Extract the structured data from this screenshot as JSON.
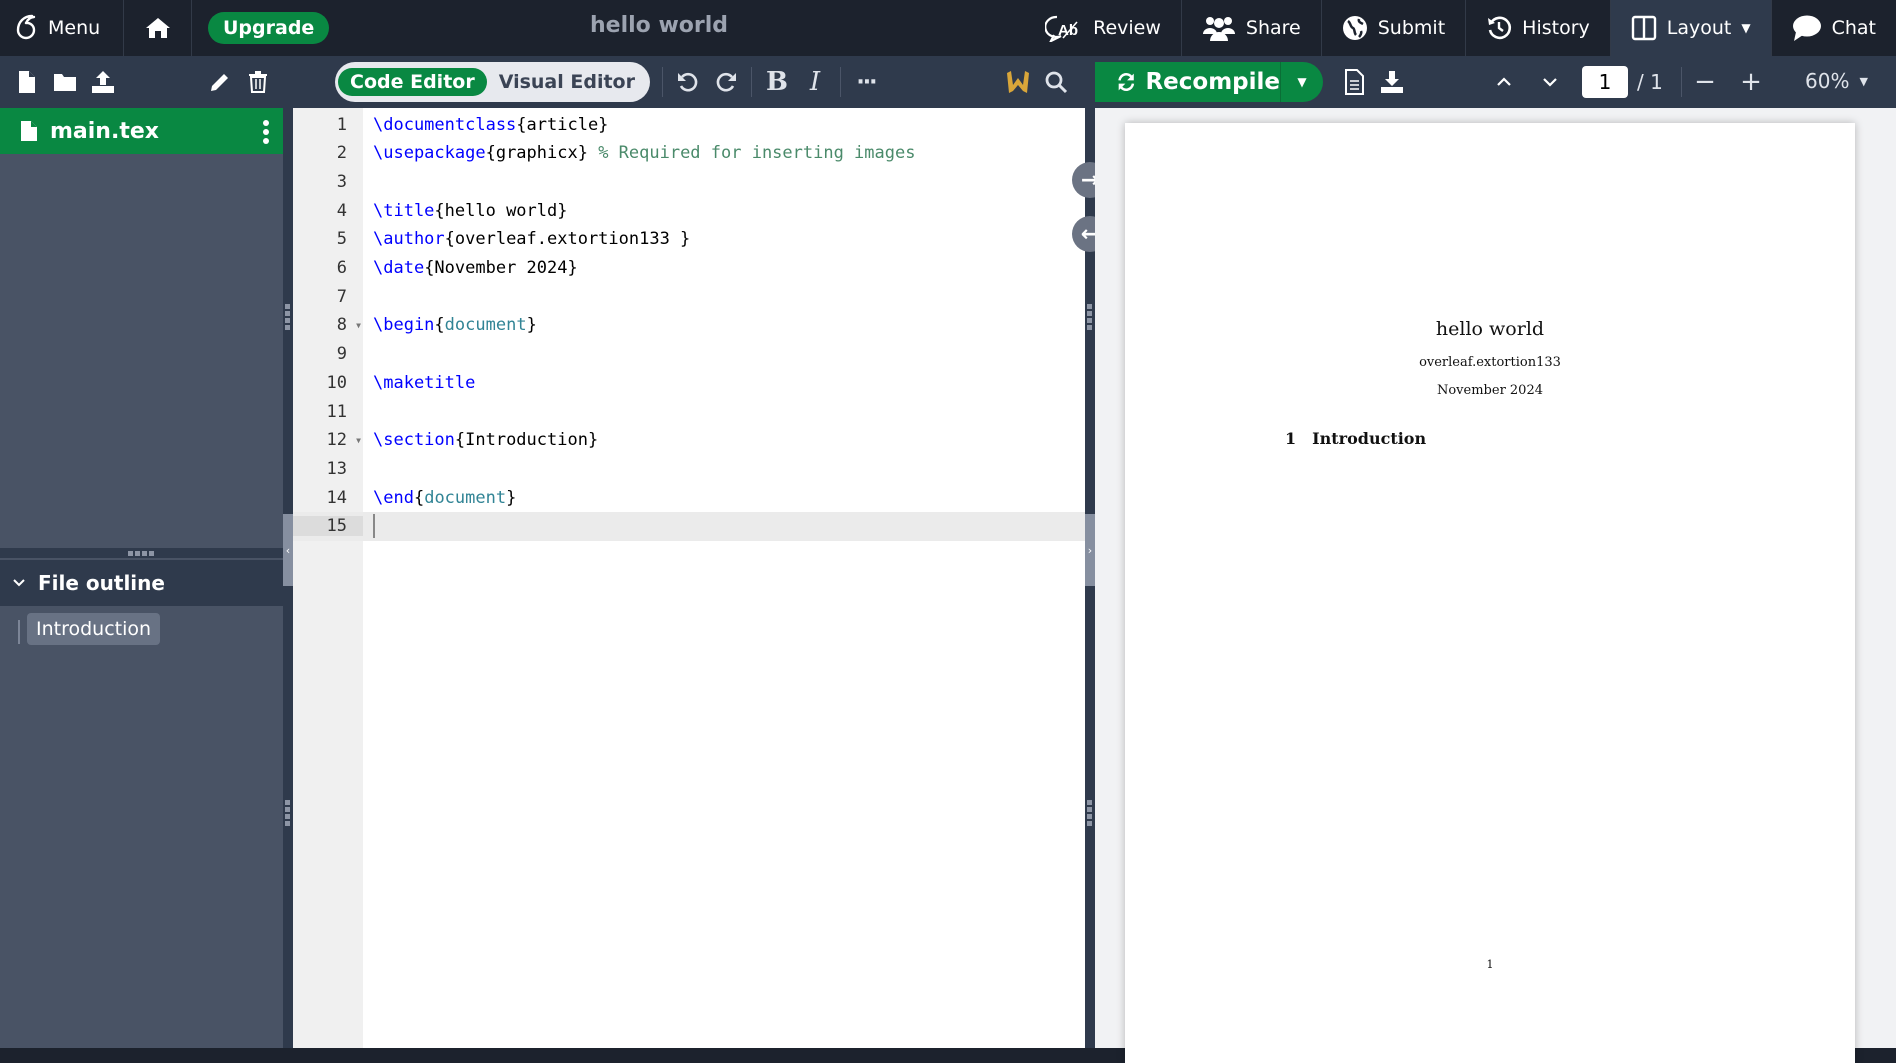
{
  "topbar": {
    "menu_label": "Menu",
    "upgrade_label": "Upgrade",
    "project_title": "hello world",
    "actions": [
      {
        "id": "review",
        "label": "Review",
        "icon": "review-icon"
      },
      {
        "id": "share",
        "label": "Share",
        "icon": "users-icon"
      },
      {
        "id": "submit",
        "label": "Submit",
        "icon": "globe-icon"
      },
      {
        "id": "history",
        "label": "History",
        "icon": "history-icon"
      },
      {
        "id": "layout",
        "label": "Layout",
        "icon": "layout-icon"
      },
      {
        "id": "chat",
        "label": "Chat",
        "icon": "chat-icon"
      }
    ]
  },
  "editor_toolbar": {
    "code_editor_label": "Code Editor",
    "visual_editor_label": "Visual Editor",
    "active_mode": "Code Editor"
  },
  "file_tree": {
    "files": [
      {
        "name": "main.tex",
        "selected": true
      }
    ]
  },
  "outline": {
    "title": "File outline",
    "items": [
      "Introduction"
    ]
  },
  "editor": {
    "lines": [
      {
        "n": "1",
        "parts": [
          [
            "kw",
            "\\documentclass"
          ],
          [
            "",
            "{article}"
          ]
        ]
      },
      {
        "n": "2",
        "parts": [
          [
            "kw",
            "\\usepackage"
          ],
          [
            "",
            "{graphicx} "
          ],
          [
            "cm",
            "% Required for inserting images"
          ]
        ]
      },
      {
        "n": "3",
        "parts": []
      },
      {
        "n": "4",
        "parts": [
          [
            "kw",
            "\\title"
          ],
          [
            "",
            "{hello world}"
          ]
        ]
      },
      {
        "n": "5",
        "parts": [
          [
            "kw",
            "\\author"
          ],
          [
            "",
            "{overleaf.extortion133 }"
          ]
        ]
      },
      {
        "n": "6",
        "parts": [
          [
            "kw",
            "\\date"
          ],
          [
            "",
            "{November 2024}"
          ]
        ]
      },
      {
        "n": "7",
        "parts": []
      },
      {
        "n": "8",
        "fold": true,
        "parts": [
          [
            "kw",
            "\\begin"
          ],
          [
            "",
            "{"
          ],
          [
            "env",
            "document"
          ],
          [
            "",
            "}"
          ]
        ]
      },
      {
        "n": "9",
        "parts": []
      },
      {
        "n": "10",
        "parts": [
          [
            "kw",
            "\\maketitle"
          ]
        ]
      },
      {
        "n": "11",
        "parts": []
      },
      {
        "n": "12",
        "fold": true,
        "parts": [
          [
            "kw",
            "\\section"
          ],
          [
            "",
            "{Introduction}"
          ]
        ]
      },
      {
        "n": "13",
        "parts": []
      },
      {
        "n": "14",
        "parts": [
          [
            "kw",
            "\\end"
          ],
          [
            "",
            "{"
          ],
          [
            "env",
            "document"
          ],
          [
            "",
            "}"
          ]
        ]
      },
      {
        "n": "15",
        "active": true,
        "parts": []
      }
    ]
  },
  "pdf_toolbar": {
    "recompile_label": "Recompile",
    "current_page": "1",
    "total_pages": "/ 1",
    "zoom": "60%"
  },
  "pdf": {
    "title": "hello world",
    "author": "overleaf.extortion133",
    "date": "November 2024",
    "section_number": "1",
    "section_title": "Introduction",
    "page_number": "1"
  },
  "colors": {
    "brand_green": "#098842",
    "topbar_bg": "#1c222d",
    "toolbar_bg": "#2f3a4c"
  }
}
